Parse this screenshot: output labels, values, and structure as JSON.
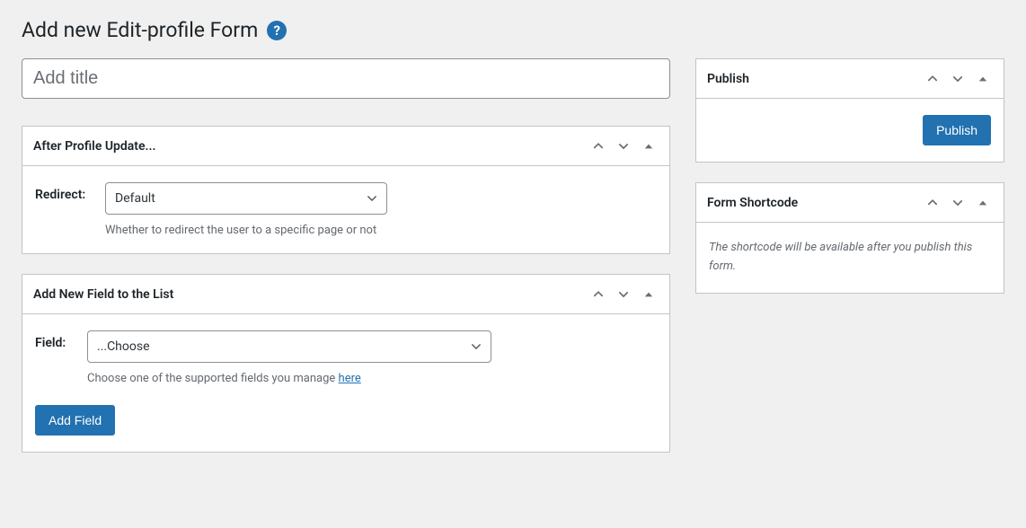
{
  "page": {
    "title": "Add new Edit-profile Form"
  },
  "title_input": {
    "placeholder": "Add title",
    "value": ""
  },
  "boxes": {
    "after_update": {
      "title": "After Profile Update...",
      "redirect_label": "Redirect:",
      "redirect_value": "Default",
      "redirect_desc": "Whether to redirect the user to a specific page or not"
    },
    "add_field": {
      "title": "Add New Field to the List",
      "field_label": "Field:",
      "field_value": "...Choose",
      "field_desc_pre": "Choose one of the supported fields you manage ",
      "field_desc_link": "here",
      "add_button": "Add Field"
    },
    "publish": {
      "title": "Publish",
      "button": "Publish"
    },
    "shortcode": {
      "title": "Form Shortcode",
      "note": "The shortcode will be available after you publish this form."
    }
  }
}
